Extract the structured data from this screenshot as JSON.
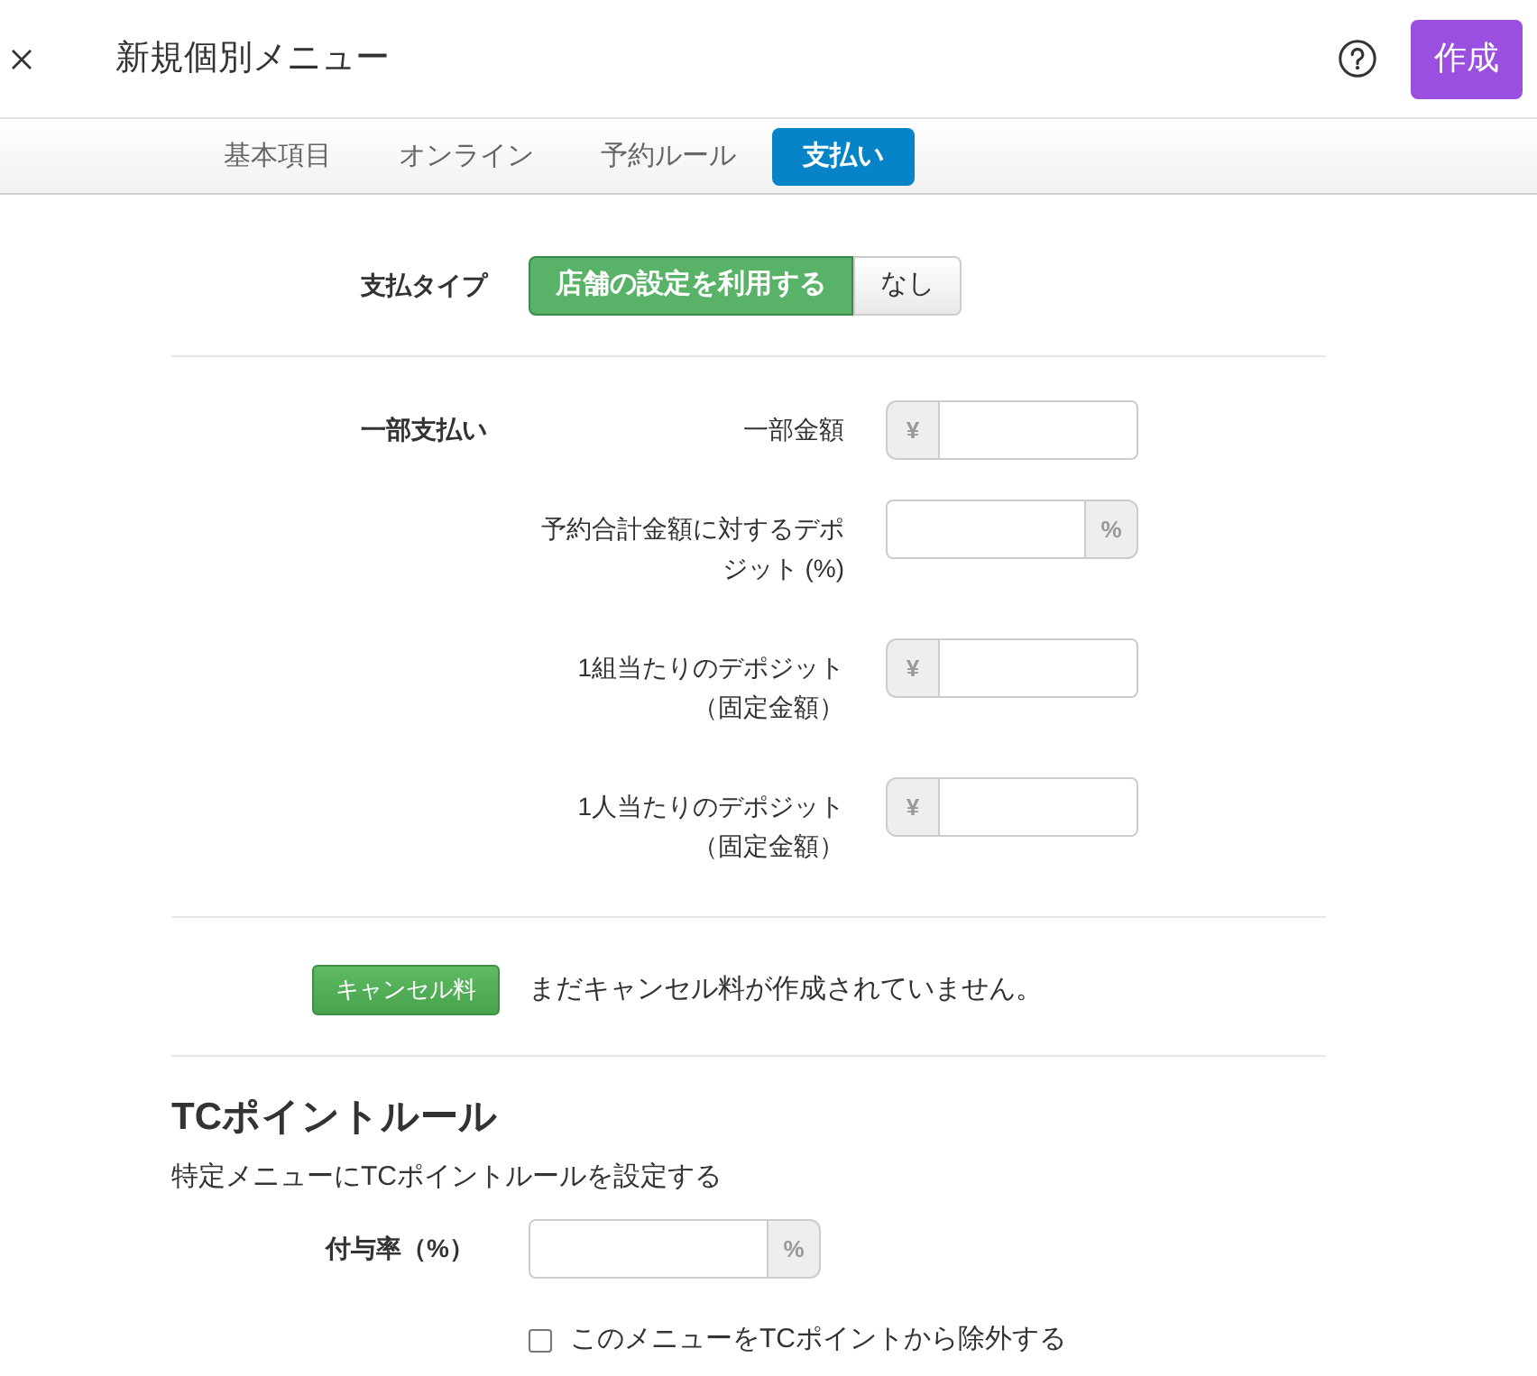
{
  "header": {
    "title": "新規個別メニュー",
    "create_button": "作成"
  },
  "tabs": [
    {
      "label": "基本項目",
      "selected": false
    },
    {
      "label": "オンライン",
      "selected": false
    },
    {
      "label": "予約ルール",
      "selected": false
    },
    {
      "label": "支払い",
      "selected": true
    }
  ],
  "payment_type": {
    "label": "支払タイプ",
    "options": [
      {
        "label": "店舗の設定を利用する",
        "selected": true
      },
      {
        "label": "なし",
        "selected": false
      }
    ]
  },
  "partial_payment": {
    "label": "一部支払い",
    "fields": [
      {
        "label": "一部金額",
        "prefix": "¥"
      },
      {
        "label": "予約合計金額に対するデポジット (%)",
        "suffix": "%"
      },
      {
        "label": "1組当たりのデポジット",
        "note": "（固定金額）",
        "prefix": "¥"
      },
      {
        "label": "1人当たりのデポジット",
        "note": "（固定金額）",
        "prefix": "¥"
      }
    ]
  },
  "cancellation": {
    "button": "キャンセル料",
    "message": "まだキャンセル料が作成されていません。"
  },
  "tc_point_rule": {
    "heading": "TCポイントルール",
    "description": "特定メニューにTCポイントルールを設定する",
    "rate_field": {
      "label": "付与率（%）",
      "suffix": "%"
    },
    "exclude_checkbox": {
      "label": "このメニューをTCポイントから除外する",
      "checked": false
    }
  }
}
